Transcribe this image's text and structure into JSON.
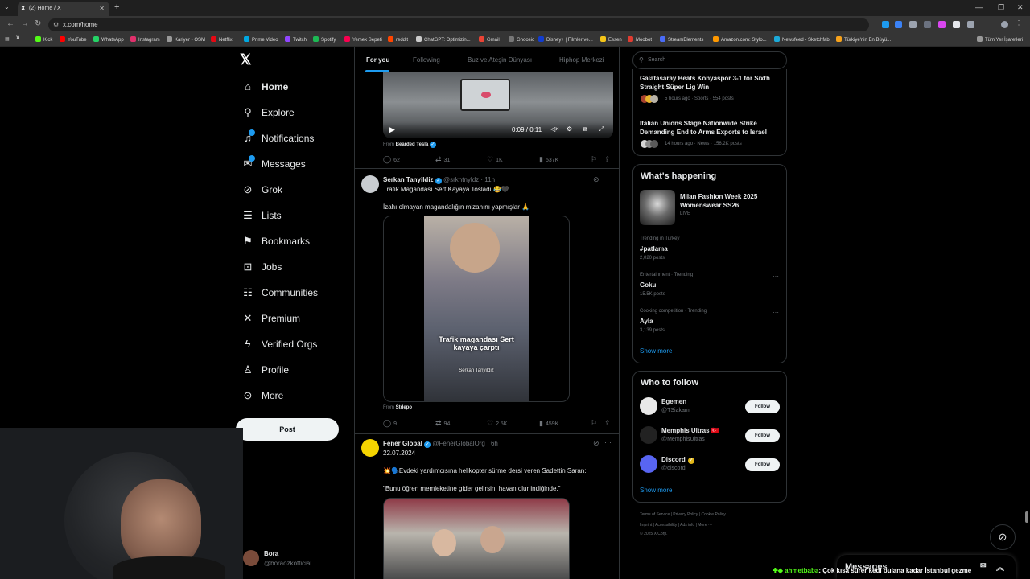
{
  "browser": {
    "tab_title": "(2) Home / X",
    "url": "x.com/home",
    "bookmarks": [
      {
        "label": "Kick",
        "color": "#53fc18"
      },
      {
        "label": "YouTube",
        "color": "#ff0000"
      },
      {
        "label": "WhatsApp",
        "color": "#25d366"
      },
      {
        "label": "Instagram",
        "color": "#e1306c"
      },
      {
        "label": "Kariyer - OSM",
        "color": "#999999"
      },
      {
        "label": "Netflix",
        "color": "#e50914"
      },
      {
        "label": "Prime Video",
        "color": "#00a8e1"
      },
      {
        "label": "Twitch",
        "color": "#9146ff"
      },
      {
        "label": "Spotify",
        "color": "#1db954"
      },
      {
        "label": "Yemek Sepeti",
        "color": "#fa0050"
      },
      {
        "label": "reddit",
        "color": "#ff4500"
      },
      {
        "label": "ChatGPT: Optimizin...",
        "color": "#cccccc"
      },
      {
        "label": "Gmail",
        "color": "#ea4335"
      },
      {
        "label": "Gnoosic",
        "color": "#777777"
      },
      {
        "label": "Disney+ | Filmler ve...",
        "color": "#113ccf"
      },
      {
        "label": "Essen",
        "color": "#f5c518"
      },
      {
        "label": "Moobot",
        "color": "#e03c31"
      },
      {
        "label": "StreamElements",
        "color": "#4a6cf7"
      },
      {
        "label": "Amazon.com: Stylo...",
        "color": "#ff9900"
      },
      {
        "label": "Newsfeed - Sketchfab",
        "color": "#1caad9"
      },
      {
        "label": "Türkiye'nin En Büyü...",
        "color": "#f7a21b"
      }
    ],
    "all_bookmarks": "Tüm Yer İşaretleri"
  },
  "nav": {
    "items": [
      {
        "label": "Home",
        "icon": "home-icon",
        "glyph": "⌂"
      },
      {
        "label": "Explore",
        "icon": "search-icon",
        "glyph": "⚲"
      },
      {
        "label": "Notifications",
        "icon": "bell-icon",
        "glyph": "♫"
      },
      {
        "label": "Messages",
        "icon": "mail-icon",
        "glyph": "✉"
      },
      {
        "label": "Grok",
        "icon": "grok-icon",
        "glyph": "⊘"
      },
      {
        "label": "Lists",
        "icon": "list-icon",
        "glyph": "☰"
      },
      {
        "label": "Bookmarks",
        "icon": "bookmark-icon",
        "glyph": "⚑"
      },
      {
        "label": "Jobs",
        "icon": "briefcase-icon",
        "glyph": "⊡"
      },
      {
        "label": "Communities",
        "icon": "people-icon",
        "glyph": "☷"
      },
      {
        "label": "Premium",
        "icon": "x-logo-icon",
        "glyph": "✕"
      },
      {
        "label": "Verified Orgs",
        "icon": "lightning-icon",
        "glyph": "ϟ"
      },
      {
        "label": "Profile",
        "icon": "person-icon",
        "glyph": "♙"
      },
      {
        "label": "More",
        "icon": "more-icon",
        "glyph": "⊙"
      }
    ],
    "post_label": "Post",
    "account": {
      "name": "Bora",
      "handle": "@boraozkofficial"
    }
  },
  "feed_tabs": [
    "For you",
    "Following",
    "Buz ve Ateşin Dünyası",
    "Hiphop Merkezi"
  ],
  "tweets": [
    {
      "video_time": "0:09 / 0:11",
      "from_label": "From",
      "from": "Bearded Tesla",
      "stats": {
        "replies": "62",
        "reposts": "31",
        "likes": "1K",
        "views": "537K"
      }
    },
    {
      "author": "Serkan Tanyildiz",
      "handle": "@srkntnyldz",
      "time": "· 11h",
      "text": "Trafik Magandası Sert Kayaya Tosladı 😂🖤",
      "text2": "İzahı olmayan magandalığın mizahını yapmışlar 🙏",
      "video_caption": "Trafik magandası Sert kayaya çarptı",
      "video_credit": "Serkan Tanyildiz",
      "from_label": "From",
      "from": "Stdepo",
      "stats": {
        "replies": "9",
        "reposts": "94",
        "likes": "2.5K",
        "views": "459K"
      }
    },
    {
      "author": "Fener Global",
      "handle": "@FenerGlobalOrg",
      "time": "· 6h",
      "date_line": "22.07.2024",
      "text": "💥🗣️Evdeki yardımcısına helikopter sürme dersi veren Sadettin Saran:",
      "text2": "\"Bunu öğren memleketine gider gelirsin, havan olur indiğinde.\""
    }
  ],
  "right": {
    "search_placeholder": "Search",
    "news": [
      {
        "title": "Galatasaray Beats Konyaspor 3-1 for Sixth Straight Süper Lig Win",
        "meta": "5 hours ago · Sports · 554 posts"
      },
      {
        "title": "Italian Unions Stage Nationwide Strike Demanding End to Arms Exports to Israel",
        "meta": "14 hours ago · News · 156.2K posts"
      }
    ],
    "whats_happening": {
      "title": "What's happening",
      "featured": {
        "title": "Milan Fashion Week 2025 Womenswear SS26",
        "status": "LIVE"
      },
      "trends": [
        {
          "context": "Trending in Turkey",
          "name": "#patlama",
          "posts": "2,020 posts"
        },
        {
          "context": "Entertainment · Trending",
          "name": "Goku",
          "posts": "15.5K posts"
        },
        {
          "context": "Cooking competition · Trending",
          "name": "Ayla",
          "posts": "3,139 posts"
        }
      ],
      "show_more": "Show more"
    },
    "who_to_follow": {
      "title": "Who to follow",
      "accounts": [
        {
          "name": "Egemen",
          "handle": "@TSiakam",
          "button": "Follow"
        },
        {
          "name": "Memphis Ultras 🇹🇷",
          "handle": "@MemphisUltras",
          "button": "Follow"
        },
        {
          "name": "Discord",
          "handle": "@discord",
          "button": "Follow"
        }
      ],
      "show_more": "Show more"
    },
    "footer": {
      "line1": "Terms of Service  |  Privacy Policy  |  Cookie Policy  |",
      "line2": "Imprint  |  Accessibility  |  Ads info  |  More ···",
      "line3": "© 2025 X Corp."
    }
  },
  "messages_drawer": "Messages",
  "chat_overlay": {
    "user": "ahmetbaba",
    "message": ": Çok kısa sürer kedi bulana kadar İstanbul gezme"
  },
  "colors": {
    "accent": "#1d9bf0",
    "background": "#000000",
    "border": "#2f3336",
    "muted": "#71767b"
  }
}
